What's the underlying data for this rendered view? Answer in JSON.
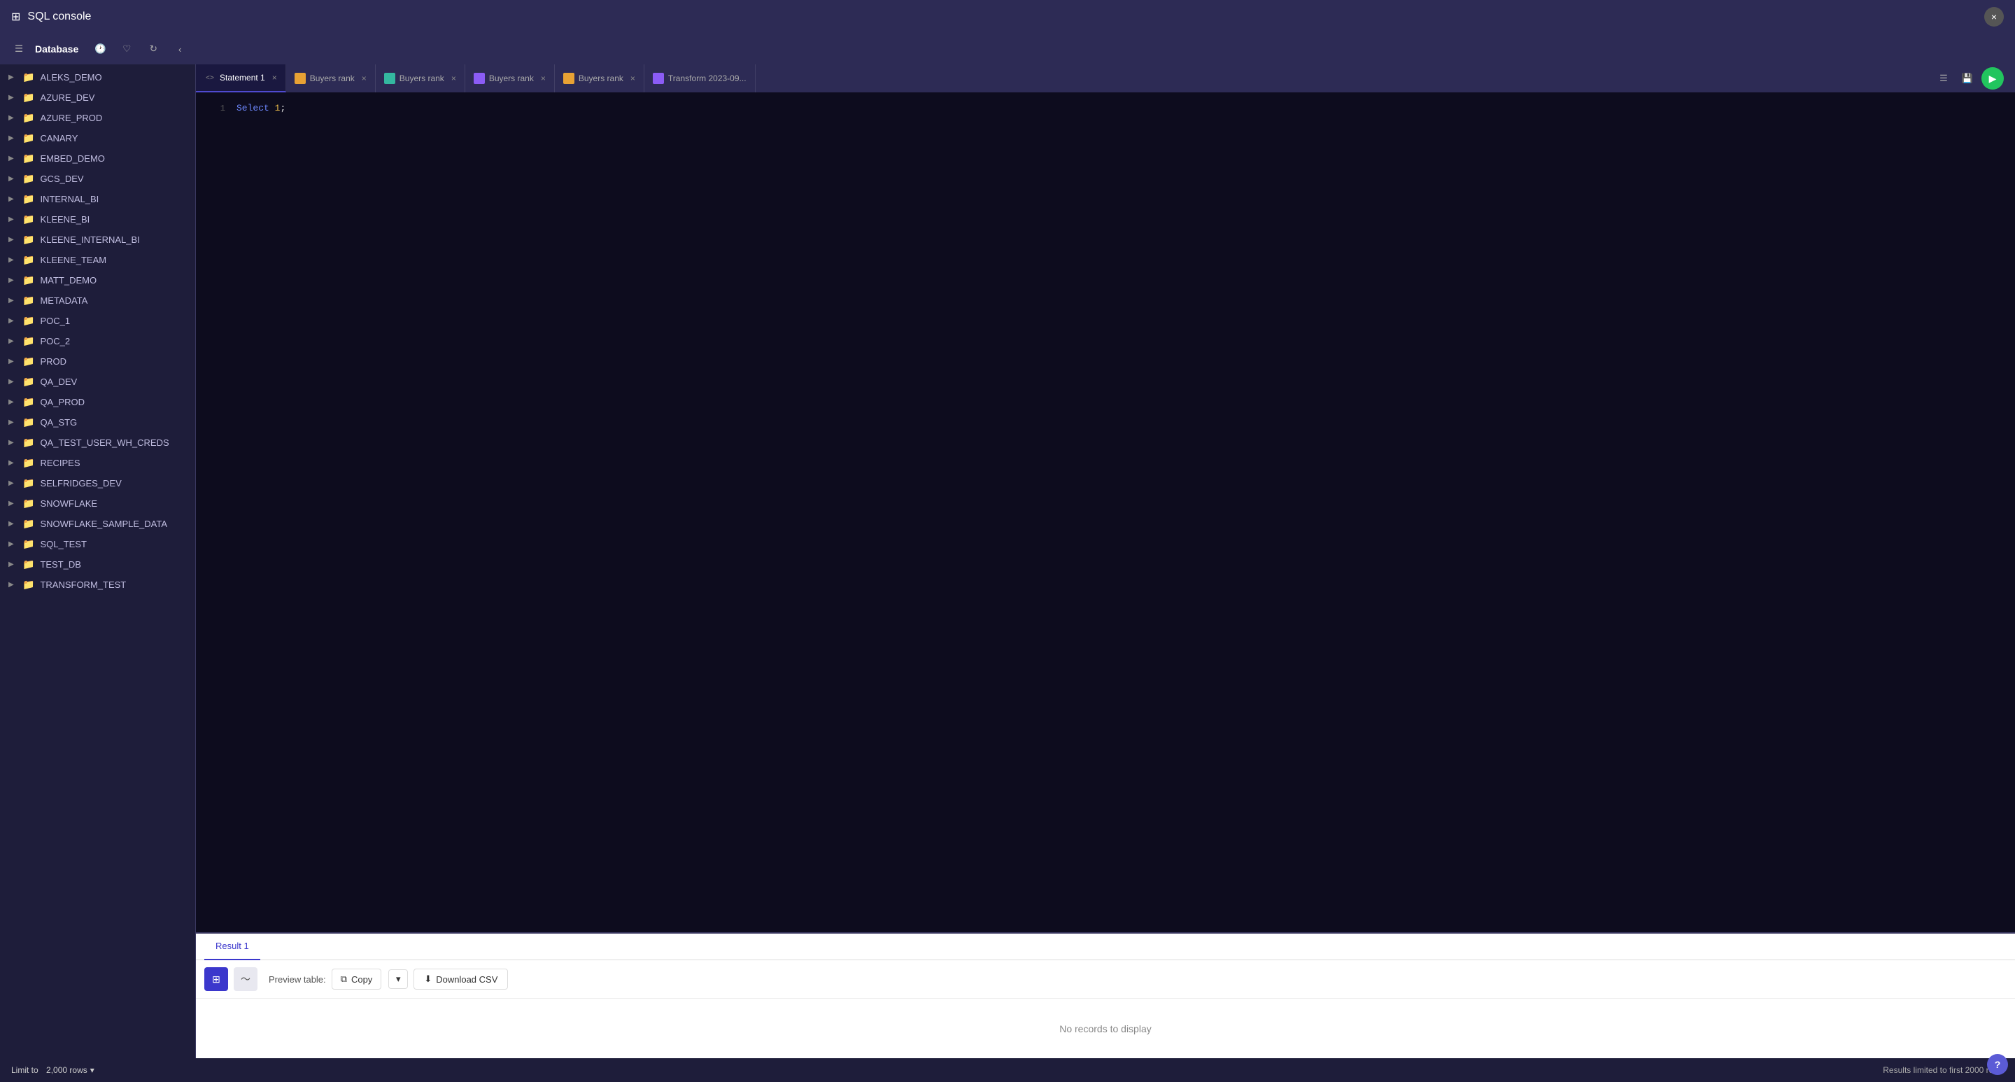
{
  "titlebar": {
    "title": "SQL console",
    "close_label": "×"
  },
  "toolbar": {
    "database_label": "Database",
    "back_label": "‹"
  },
  "sidebar": {
    "items": [
      {
        "name": "ALEKS_DEMO",
        "expanded": false
      },
      {
        "name": "AZURE_DEV",
        "expanded": false
      },
      {
        "name": "AZURE_PROD",
        "expanded": false
      },
      {
        "name": "CANARY",
        "expanded": false
      },
      {
        "name": "EMBED_DEMO",
        "expanded": false
      },
      {
        "name": "GCS_DEV",
        "expanded": false
      },
      {
        "name": "INTERNAL_BI",
        "expanded": false
      },
      {
        "name": "KLEENE_BI",
        "expanded": false
      },
      {
        "name": "KLEENE_INTERNAL_BI",
        "expanded": false
      },
      {
        "name": "KLEENE_TEAM",
        "expanded": false
      },
      {
        "name": "MATT_DEMO",
        "expanded": false
      },
      {
        "name": "METADATA",
        "expanded": false
      },
      {
        "name": "POC_1",
        "expanded": false
      },
      {
        "name": "POC_2",
        "expanded": false
      },
      {
        "name": "PROD",
        "expanded": false
      },
      {
        "name": "QA_DEV",
        "expanded": false
      },
      {
        "name": "QA_PROD",
        "expanded": false
      },
      {
        "name": "QA_STG",
        "expanded": false
      },
      {
        "name": "QA_TEST_USER_WH_CREDS",
        "expanded": false
      },
      {
        "name": "RECIPES",
        "expanded": false
      },
      {
        "name": "SELFRIDGES_DEV",
        "expanded": false
      },
      {
        "name": "SNOWFLAKE",
        "expanded": false
      },
      {
        "name": "SNOWFLAKE_SAMPLE_DATA",
        "expanded": false
      },
      {
        "name": "SQL_TEST",
        "expanded": false
      },
      {
        "name": "TEST_DB",
        "expanded": false
      },
      {
        "name": "TRANSFORM_TEST",
        "expanded": false
      }
    ]
  },
  "tabs": [
    {
      "id": "stmt1",
      "label": "Statement 1",
      "type": "sql",
      "active": true,
      "closable": true
    },
    {
      "id": "br1",
      "label": "Buyers rank",
      "type": "orange",
      "active": false,
      "closable": true
    },
    {
      "id": "br2",
      "label": "Buyers rank",
      "type": "teal",
      "active": false,
      "closable": true
    },
    {
      "id": "br3",
      "label": "Buyers rank",
      "type": "purple",
      "active": false,
      "closable": true
    },
    {
      "id": "br4",
      "label": "Buyers rank",
      "type": "orange2",
      "active": false,
      "closable": true
    },
    {
      "id": "tr1",
      "label": "Transform 2023-09...",
      "type": "purple2",
      "active": false,
      "closable": false
    }
  ],
  "editor": {
    "lines": [
      {
        "number": "1",
        "content": "Select 1;"
      }
    ]
  },
  "results": {
    "tabs": [
      {
        "label": "Result 1",
        "active": true
      }
    ],
    "toolbar": {
      "preview_label": "Preview table:",
      "copy_label": "Copy",
      "download_label": "Download CSV"
    },
    "empty_message": "No records to display"
  },
  "bottom_bar": {
    "limit_label": "Limit to",
    "limit_value": "2,000 rows",
    "results_info": "Results limited to first 2000 rows"
  },
  "help": {
    "label": "?"
  }
}
